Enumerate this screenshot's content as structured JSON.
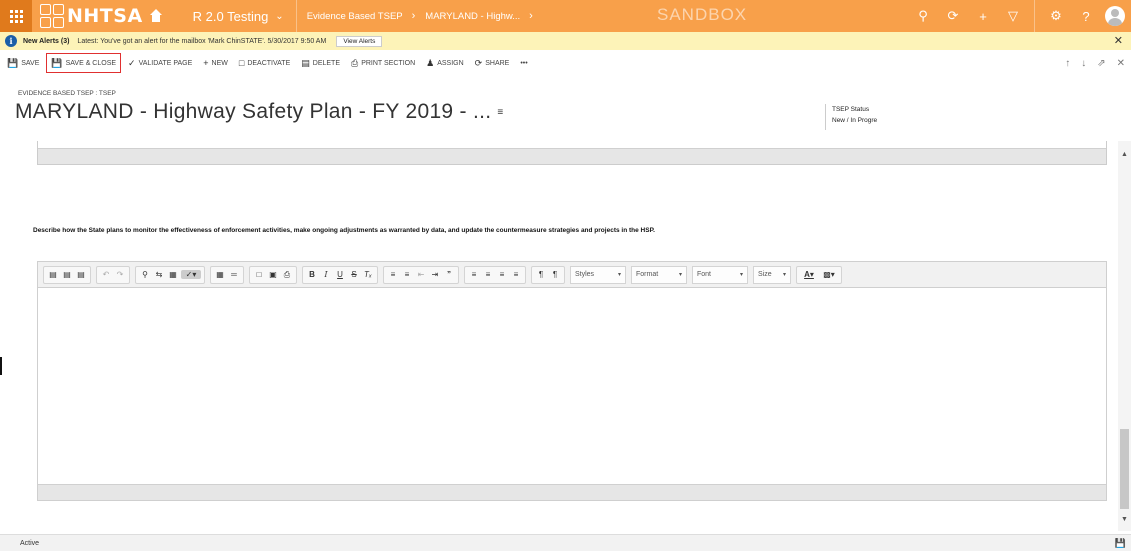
{
  "topnav": {
    "brand": "NHTSA",
    "app_name": "R 2.0 Testing",
    "breadcrumb": [
      "Evidence Based TSEP",
      "MARYLAND - Highw..."
    ],
    "environment": "SANDBOX"
  },
  "alerts": {
    "title": "New Alerts (3)",
    "latest": "Latest: You've got an alert for the mailbox 'Mark ChinSTATE'. 5/30/2017 9:50 AM",
    "view_label": "View Alerts"
  },
  "commands": {
    "save": "SAVE",
    "save_close": "SAVE & CLOSE",
    "validate": "VALIDATE PAGE",
    "new": "NEW",
    "deactivate": "DEACTIVATE",
    "delete": "DELETE",
    "print": "PRINT SECTION",
    "assign": "ASSIGN",
    "share": "SHARE",
    "more": "•••"
  },
  "header": {
    "entity_type": "EVIDENCE BASED TSEP : TSEP",
    "title": "MARYLAND - Highway Safety Plan - FY 2019 - ...",
    "status_label": "TSEP Status",
    "status_value": "New / In Progre"
  },
  "form": {
    "question": "Describe how the State plans to monitor the effectiveness of enforcement activities, make ongoing adjustments as warranted by data, and update the countermeasure strategies and projects in the HSP.",
    "editor_dropdowns": {
      "styles": "Styles",
      "format": "Format",
      "font": "Font",
      "size": "Size"
    }
  },
  "footer": {
    "status": "Active"
  },
  "colors": {
    "nav": "#f8a04a",
    "alert_bg": "#fdf3b8",
    "highlight": "#e03030"
  }
}
